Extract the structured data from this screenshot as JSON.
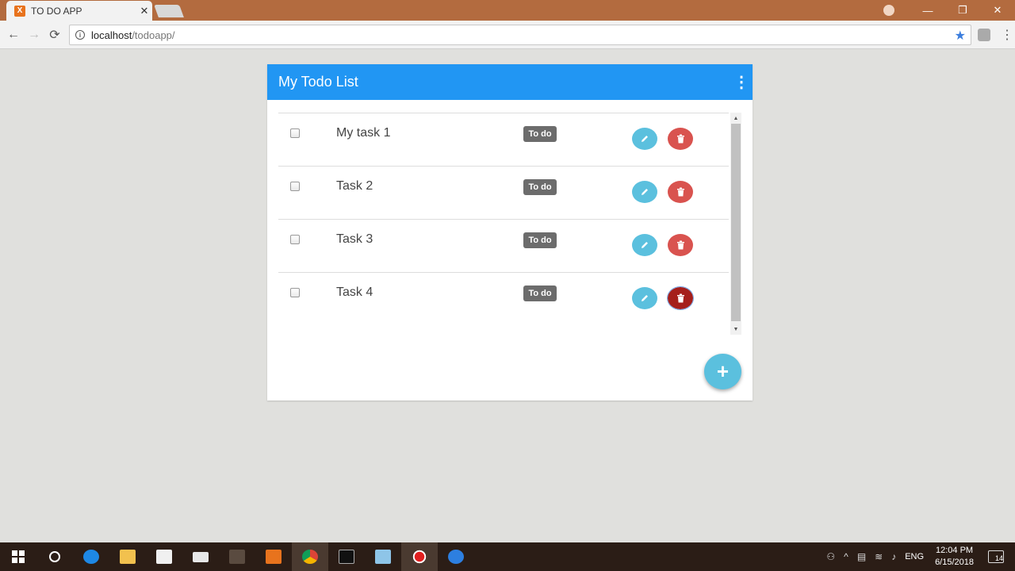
{
  "browser": {
    "tab_title": "TO DO APP",
    "tab_favicon": "X",
    "tab_close": "✕",
    "url_host": "localhost",
    "url_path": "/todoapp/",
    "back_glyph": "←",
    "forward_glyph": "→",
    "reload_glyph": "⟳",
    "info_glyph": "i",
    "star_glyph": "★",
    "menu_glyph": "⋮",
    "minimize_glyph": "—",
    "restore_glyph": "❐",
    "close_glyph": "✕"
  },
  "app": {
    "title": "My Todo List",
    "menu_glyph": "⋮",
    "tasks": [
      {
        "label": "My task 1",
        "status": "To do"
      },
      {
        "label": "Task 2",
        "status": "To do"
      },
      {
        "label": "Task 3",
        "status": "To do"
      },
      {
        "label": "Task 4",
        "status": "To do"
      }
    ],
    "add_glyph": "+",
    "colors": {
      "header": "#2196f3",
      "edit": "#5bc0de",
      "delete": "#d9534f",
      "badge": "#6c6c6c"
    }
  },
  "taskbar": {
    "lang": "ENG",
    "time": "12:04 PM",
    "date": "6/15/2018",
    "notifications": "14"
  },
  "icons": {
    "edit": "pencil-icon",
    "delete": "trash-icon",
    "add": "plus-icon"
  }
}
